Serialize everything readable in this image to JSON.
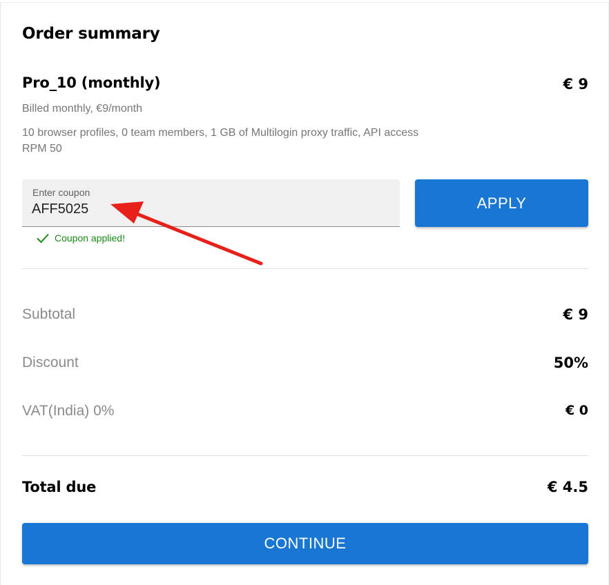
{
  "summary": {
    "title": "Order summary"
  },
  "plan": {
    "name": "Pro_10 (monthly)",
    "price": "€ 9",
    "billing": "Billed monthly, €9/month",
    "features": "10 browser profiles, 0 team members, 1 GB of Multilogin proxy traffic, API access RPM 50"
  },
  "coupon": {
    "label": "Enter coupon",
    "value": "AFF5025",
    "apply_label": "APPLY",
    "status": "Coupon applied!",
    "status_icon": "check-icon"
  },
  "breakdown": {
    "subtotal_label": "Subtotal",
    "subtotal_value": "€ 9",
    "discount_label": "Discount",
    "discount_value": "50%",
    "vat_label": "VAT(India) 0%",
    "vat_value": "€ 0"
  },
  "total": {
    "label": "Total due",
    "value": "€ 4.5"
  },
  "continue_label": "CONTINUE",
  "annotation": {
    "icon": "red-arrow-icon",
    "color": "#e8201a"
  },
  "colors": {
    "primary": "#1976d2",
    "success": "#1a8a1a",
    "muted_text": "#8a8a8a"
  }
}
